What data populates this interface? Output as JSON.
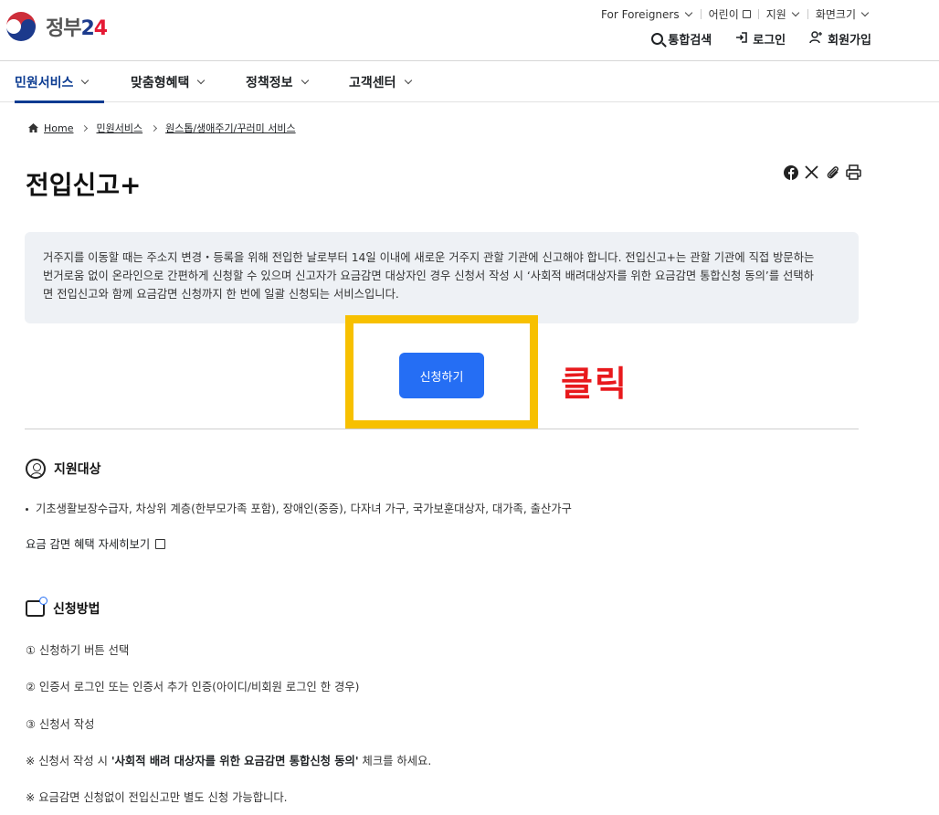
{
  "header": {
    "logo_text": "정부",
    "logo_num": "2",
    "logo_num2": "4",
    "util": {
      "foreigners": "For Foreigners",
      "kids": "어린이",
      "support": "지원",
      "screen_size": "화면크기"
    },
    "actions": {
      "search": "통합검색",
      "login": "로그인",
      "signup": "회원가입"
    }
  },
  "gnb": [
    {
      "label": "민원서비스",
      "active": true
    },
    {
      "label": "맞춤형혜택",
      "active": false
    },
    {
      "label": "정책정보",
      "active": false
    },
    {
      "label": "고객센터",
      "active": false
    }
  ],
  "breadcrumb": [
    "Home",
    "민원서비스",
    "원스톱/생애주기/꾸러미 서비스"
  ],
  "page": {
    "title": "전입신고+",
    "description_lines": [
      "거주지를 이동할 때는 주소지 변경・등록을 위해 전입한 날로부터 14일 이내에 새로운 거주지 관할 기관에 신고해야 합니다. 전입신고+는 관할 기관에 직접 방문하는",
      "번거로움 없이 온라인으로 간편하게 신청할 수 있으며 신고자가 요금감면 대상자인 경우 신청서 작성 시 ‘사회적 배려대상자를 위한 요금감면 통합신청 동의’를 선택하",
      "면 전입신고와 함께 요금감면 신청까지 한 번에 일괄 신청되는 서비스입니다."
    ],
    "apply_button": "신청하기",
    "annotation": "클릭"
  },
  "target": {
    "heading": "지원대상",
    "item": "기초생활보장수급자, 차상위 계층(한부모가족 포함), 장애인(중증), 다자녀 가구, 국가보훈대상자, 대가족, 출산가구",
    "link": "요금 감면 혜택 자세히보기"
  },
  "method": {
    "heading": "신청방법",
    "steps": [
      "① 신청하기 버튼 선택",
      "② 인증서 로그인 또는 인증서 추가 인증(아이디/비회원 로그인 한 경우)",
      "③ 신청서 작성"
    ],
    "note1_prefix": "※ 신청서 작성 시 ",
    "note1_bold": "'사회적 배려 대상자를 위한 요금감면 통합신청 동의'",
    "note1_suffix": " 체크를 하세요.",
    "note2": "※ 요금감면 신청없이 전입신고만 별도 신청 가능합니다."
  },
  "colors": {
    "primary": "#256ef4",
    "nav_active": "#0b3b91",
    "highlight": "#f7c000",
    "annotation": "#e8191c"
  }
}
